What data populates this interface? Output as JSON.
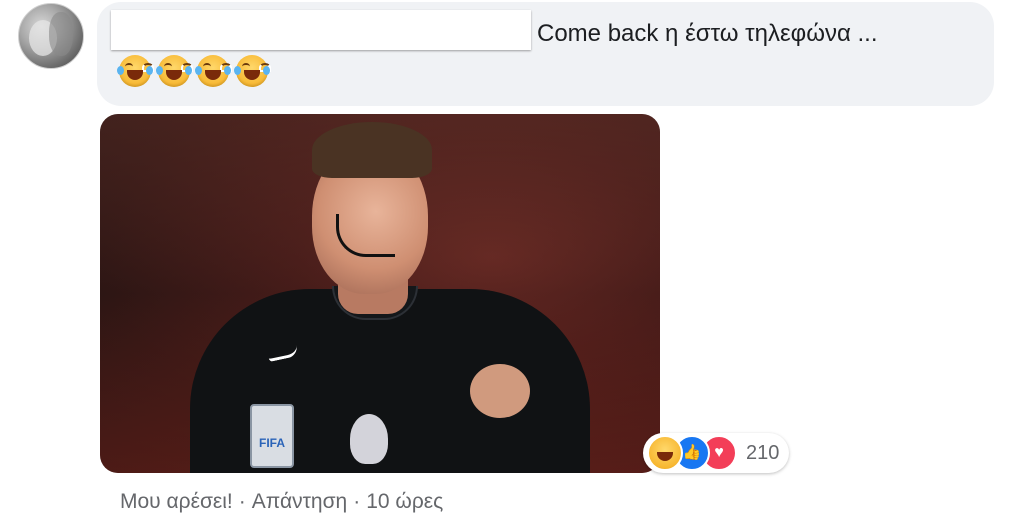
{
  "comment": {
    "text": "Come back η έστω τηλεφώνα ...",
    "emoji_icons": [
      "laughing-crying-emoji",
      "laughing-crying-emoji",
      "laughing-crying-emoji",
      "laughing-crying-emoji"
    ]
  },
  "photo": {
    "badge_text": "FIFA"
  },
  "reactions": {
    "icons": [
      "haha-icon",
      "like-icon",
      "love-icon"
    ],
    "count": "210",
    "colors": {
      "like": "#1877f2",
      "love": "#f33e58",
      "haha": "#f7b731"
    }
  },
  "actions": {
    "like_label": "Μου αρέσει!",
    "reply_label": "Απάντηση",
    "separator": "·",
    "time": "10 ώρες"
  }
}
